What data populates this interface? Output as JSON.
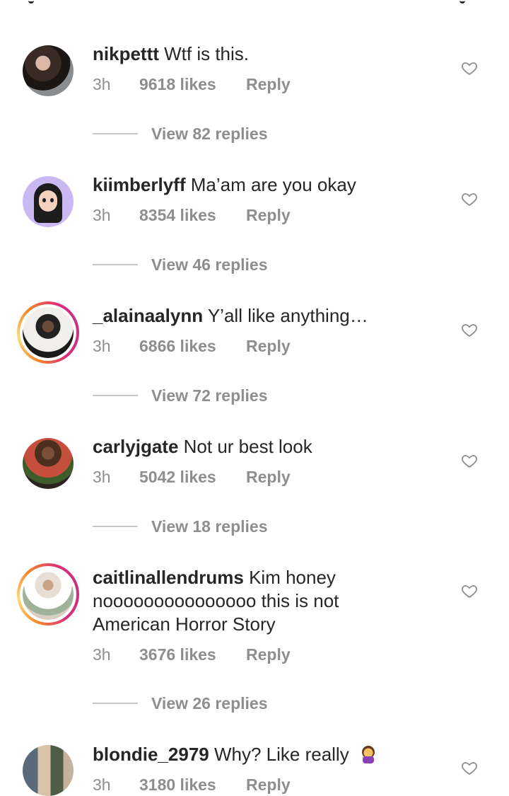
{
  "comments": [
    {
      "username": "nikpettt",
      "text": "Wtf is this.",
      "time": "3h",
      "likes": "9618 likes",
      "reply": "Reply",
      "view_replies": "View 82 replies"
    },
    {
      "username": "kiimberlyff",
      "text": "Ma’am are you okay",
      "time": "3h",
      "likes": "8354 likes",
      "reply": "Reply",
      "view_replies": "View 46 replies"
    },
    {
      "username": "_alainaalynn",
      "text": "Y’all like anything…",
      "time": "3h",
      "likes": "6866 likes",
      "reply": "Reply",
      "view_replies": "View 72 replies"
    },
    {
      "username": "carlyjgate",
      "text": "Not ur best look",
      "time": "3h",
      "likes": "5042 likes",
      "reply": "Reply",
      "view_replies": "View 18 replies"
    },
    {
      "username": "caitlinallendrums",
      "text": "Kim honey nooooooooooooooo this is not American Horror Story",
      "time": "3h",
      "likes": "3676 likes",
      "reply": "Reply",
      "view_replies": "View 26 replies"
    },
    {
      "username": "blondie_2979",
      "text": "Why? Like really",
      "emoji": "woman-facepalming-icon",
      "time": "3h",
      "likes": "3180 likes",
      "reply": "Reply"
    }
  ],
  "colors": {
    "text": "#262626",
    "meta": "#8e8e8e",
    "divider": "#c7c7c7",
    "story_ring": [
      "#f58529",
      "#dd2a7b",
      "#c13584"
    ]
  }
}
